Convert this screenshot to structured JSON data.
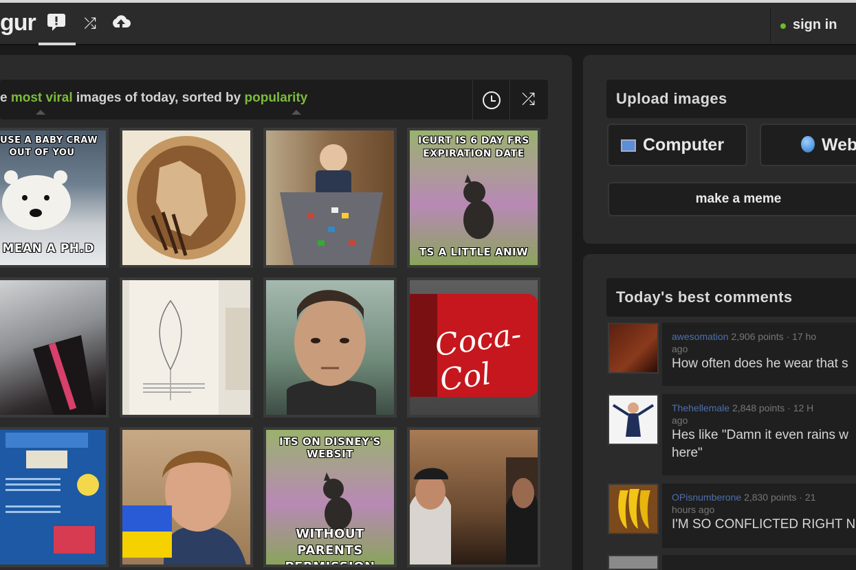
{
  "header": {
    "logo_text": "gur",
    "signin_label": "sign in"
  },
  "gallery": {
    "filter": {
      "prefix": "e ",
      "viral_word": "most viral",
      "middle": " images of today, sorted by ",
      "sort_word": "popularity"
    },
    "tiles": [
      {
        "top_caption": "CAUSE A BABY CRAW OUT OF YOU",
        "bottom_caption": "T MEAN A PH.D"
      },
      {
        "top_caption": "",
        "bottom_caption": ""
      },
      {
        "top_caption": "",
        "bottom_caption": ""
      },
      {
        "top_caption": "ICURT IS 6 DAY FRS EXPIRATION DATE",
        "bottom_caption": "TS A LITTLE ANIW"
      },
      {
        "top_caption": "",
        "bottom_caption": ""
      },
      {
        "top_caption": "",
        "bottom_caption": ""
      },
      {
        "top_caption": "",
        "bottom_caption": ""
      },
      {
        "top_caption": "Coca-Col",
        "bottom_caption": ""
      },
      {
        "top_caption": "",
        "bottom_caption": ""
      },
      {
        "top_caption": "",
        "bottom_caption": ""
      },
      {
        "top_caption": "ITS ON DISNEY'S WEBSIT",
        "bottom_caption": "WITHOUT PARENTS PERMISSION"
      },
      {
        "top_caption": "",
        "bottom_caption": ""
      }
    ]
  },
  "upload": {
    "title": "Upload images",
    "computer_label": "Computer",
    "web_label": "Web",
    "meme_label": "make a meme"
  },
  "comments": {
    "title": "Today's best comments",
    "items": [
      {
        "user": "awesomation",
        "points": "2,906 points",
        "time": "17 ho",
        "ago": "ago",
        "text": "How often does he wear that s"
      },
      {
        "user": "Thehellemale",
        "points": "2,848 points",
        "time": "12 H",
        "ago": "ago",
        "text": "Hes like \"Damn it even rains w here\""
      },
      {
        "user": "OPisnumberone",
        "points": "2,830 points",
        "time": "21",
        "ago": "hours ago",
        "text": "I'M SO CONFLICTED RIGHT N"
      }
    ]
  },
  "colors": {
    "accent_green": "#7cbb3a",
    "username_blue": "#4e6fae",
    "panel_bg": "#2b2b2b"
  }
}
